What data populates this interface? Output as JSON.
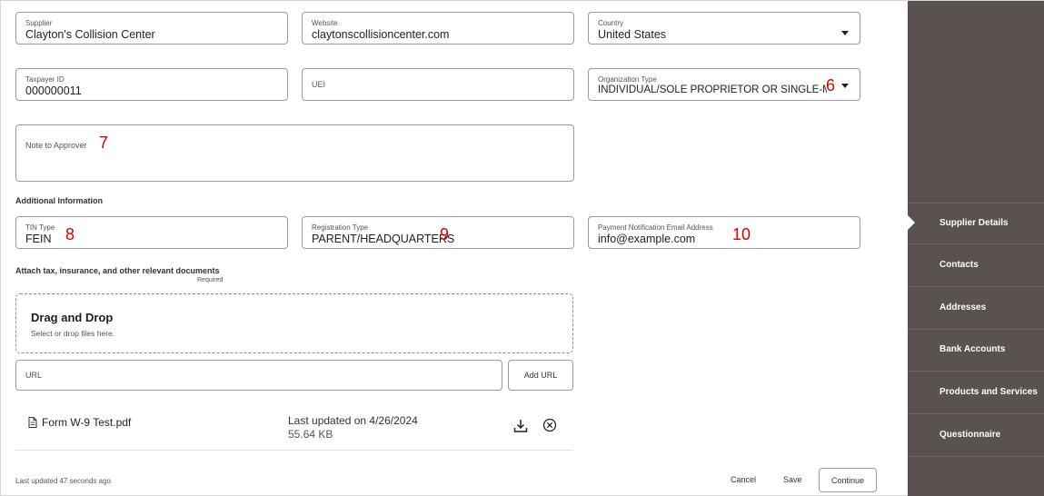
{
  "form": {
    "supplier": {
      "label": "Supplier",
      "value": "Clayton's Collision Center"
    },
    "website": {
      "label": "Website",
      "value": "claytonscollisioncenter.com"
    },
    "country": {
      "label": "Country",
      "value": "United States"
    },
    "taxpayer_id": {
      "label": "Taxpayer ID",
      "value": "000000011"
    },
    "uei": {
      "label": "UEI"
    },
    "organization_type": {
      "label": "Organization Type",
      "value": "INDIVIDUAL/SOLE PROPRIETOR OR SINGLE-MEN"
    },
    "note_to_approver": {
      "label": "Note to Approver"
    }
  },
  "additional": {
    "heading": "Additional Information",
    "tin_type": {
      "label": "TIN Type",
      "value": "FEIN"
    },
    "registration_type": {
      "label": "Registration Type",
      "value": "PARENT/HEADQUARTERS"
    },
    "payment_email": {
      "label": "Payment Notification Email Address",
      "value": "info@example.com"
    }
  },
  "attachments": {
    "heading": "Attach tax, insurance, and other relevant documents",
    "required": "Required",
    "drop_title": "Drag and Drop",
    "drop_sub": "Select or drop files here.",
    "url_label": "URL",
    "add_url": "Add URL",
    "file": {
      "name": "Form W-9 Test.pdf",
      "updated": "Last updated on 4/26/2024",
      "size": "55.64 KB"
    }
  },
  "markers": {
    "m6": "6",
    "m7": "7",
    "m8": "8",
    "m9": "9",
    "m10": "10"
  },
  "footer": {
    "last_updated": "Last updated 47 seconds ago",
    "cancel": "Cancel",
    "save": "Save",
    "continue": "Continue"
  },
  "sidebar": {
    "items": [
      {
        "label": "Supplier Details",
        "active": true
      },
      {
        "label": "Contacts"
      },
      {
        "label": "Addresses"
      },
      {
        "label": "Bank Accounts"
      },
      {
        "label": "Products and Services"
      },
      {
        "label": "Questionnaire"
      }
    ]
  },
  "icons": {
    "dropdown": "chevron-down-icon",
    "file": "document-icon",
    "download": "download-icon",
    "remove": "close-circle-icon"
  },
  "colors": {
    "sidebar_bg": "#59524e",
    "marker": "#e00000"
  }
}
